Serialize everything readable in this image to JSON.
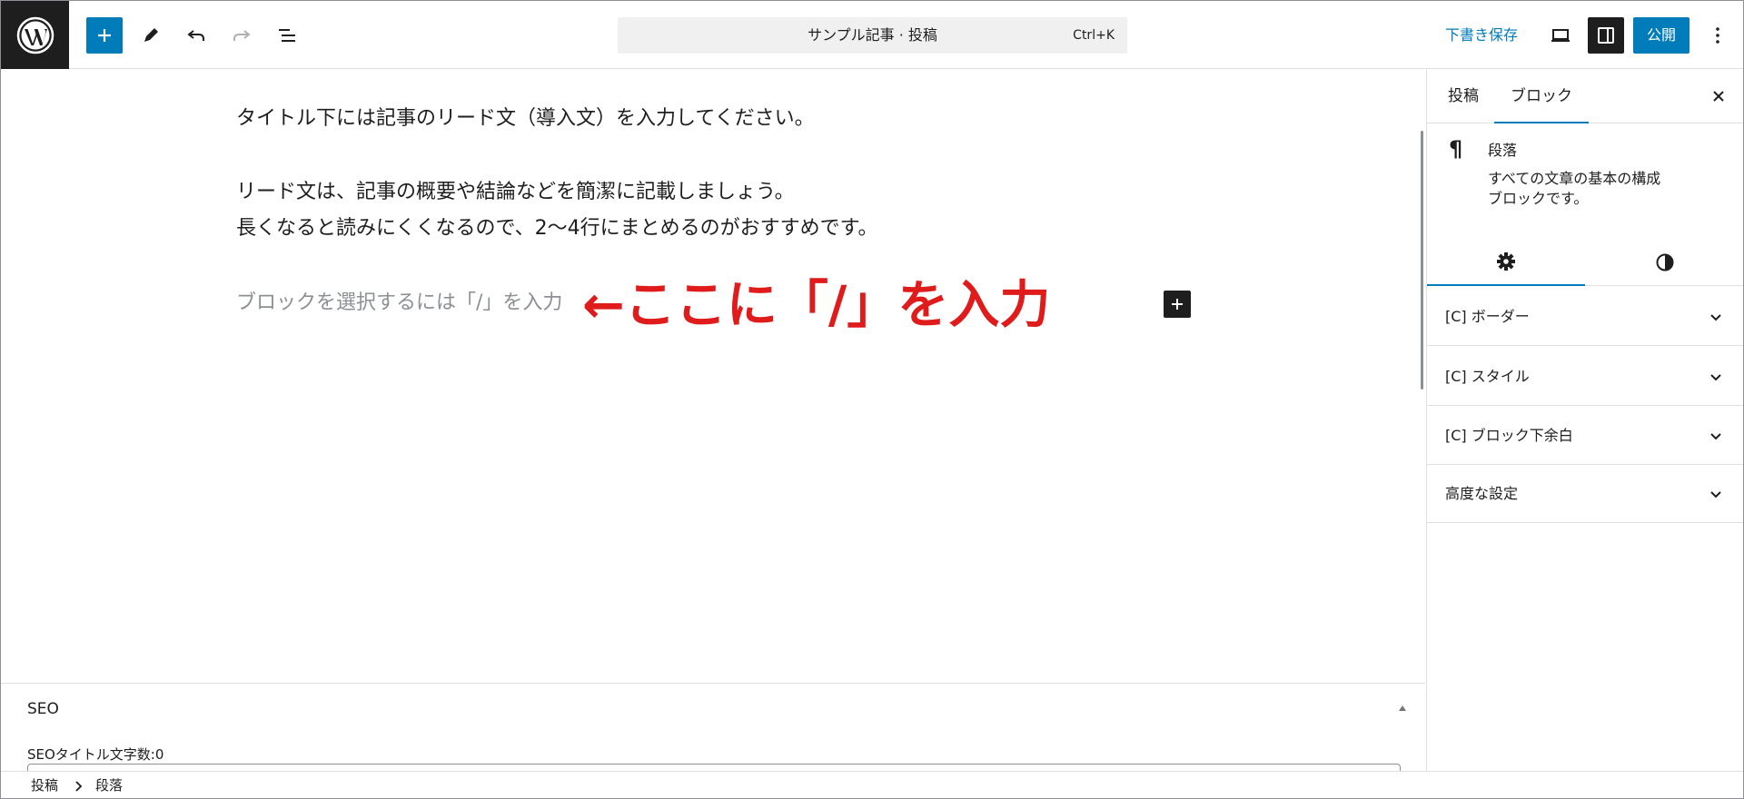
{
  "topbar": {
    "inserter_icon": "plus-icon",
    "tools": [
      "pencil-icon",
      "undo-icon",
      "redo-icon",
      "list-view-icon"
    ],
    "command_bar": {
      "title": "サンプル記事 · 投稿",
      "shortcut": "Ctrl+K"
    },
    "save_draft_label": "下書き保存",
    "publish_label": "公開",
    "accent_color": "#007cba"
  },
  "content": {
    "paragraphs": [
      "タイトル下には記事のリード文（導入文）を入力してください。",
      "リード文は、記事の概要や結論などを簡潔に記載しましょう。",
      "長くなると読みにくくなるので、2〜4行にまとめるのがおすすめです。"
    ],
    "placeholder": "ブロックを選択するには「/」を入力",
    "annotation": "←ここに「/」を入力",
    "annotation_color": "#e01b1b"
  },
  "seo": {
    "title": "SEO",
    "title_count_label": "SEOタイトル文字数:0"
  },
  "breadcrumb": {
    "items": [
      "投稿",
      "段落"
    ]
  },
  "sidebar": {
    "tabs": {
      "post": "投稿",
      "block": "ブロック"
    },
    "block": {
      "name": "段落",
      "description": "すべての文章の基本の構成ブロックです。"
    },
    "panels": [
      "[C] ボーダー",
      "[C] スタイル",
      "[C] ブロック下余白",
      "高度な設定"
    ]
  }
}
